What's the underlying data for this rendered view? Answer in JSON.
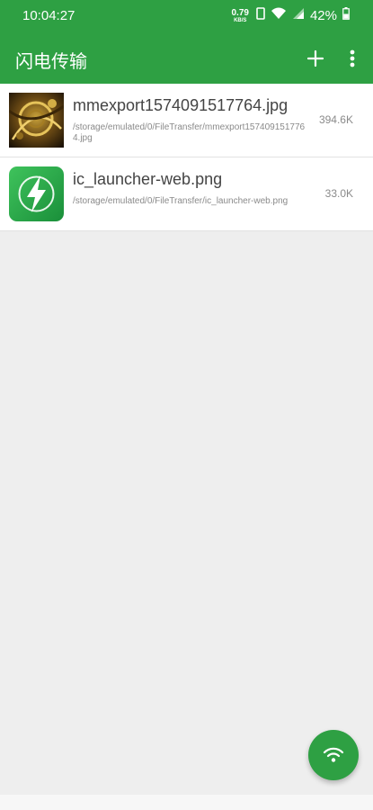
{
  "status_bar": {
    "time": "10:04:27",
    "net_speed_value": "0.79",
    "net_speed_unit": "KB/S",
    "battery": "42%"
  },
  "app_bar": {
    "title": "闪电传输",
    "add_icon": "plus-icon",
    "more_icon": "more-vert-icon"
  },
  "files": [
    {
      "name": "mmexport1574091517764.jpg",
      "path": "/storage/emulated/0/FileTransfer/mmexport1574091517764.jpg",
      "size": "394.6K",
      "thumb": "photo-thumbnail"
    },
    {
      "name": "ic_launcher-web.png",
      "path": "/storage/emulated/0/FileTransfer/ic_launcher-web.png",
      "size": "33.0K",
      "thumb": "lightning-app-icon"
    }
  ],
  "fab": {
    "icon": "wifi-icon"
  },
  "colors": {
    "accent": "#2ea043",
    "background": "#eeeeee",
    "card": "#ffffff"
  }
}
